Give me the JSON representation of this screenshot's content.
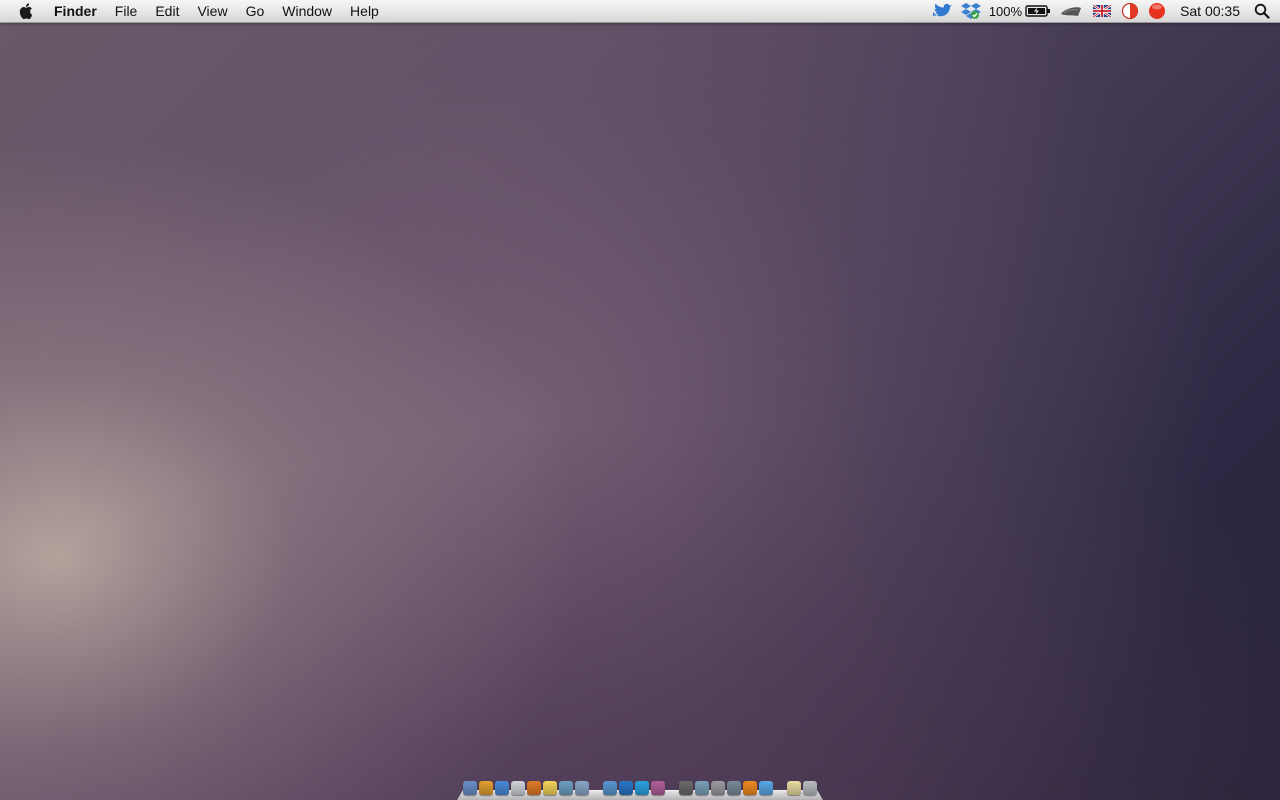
{
  "menubar": {
    "app_name": "Finder",
    "menus": [
      "File",
      "Edit",
      "View",
      "Go",
      "Window",
      "Help"
    ],
    "battery": "100%",
    "clock": "Sat 00:35"
  },
  "status_icons": [
    "twitter-icon",
    "dropbox-icon",
    "battery-icon",
    "wifi-icon",
    "input-flag-uk-icon",
    "display-toggle-icon",
    "record-dot-icon",
    "spotlight-icon"
  ],
  "dock": {
    "apps": [
      {
        "name": "finder-icon",
        "color": "#6a8fc8"
      },
      {
        "name": "chrome-icon",
        "color": "#e0a030"
      },
      {
        "name": "safari-icon",
        "color": "#4a8ad8"
      },
      {
        "name": "preview-icon",
        "color": "#cfd4da"
      },
      {
        "name": "tasks-icon",
        "color": "#e07a28"
      },
      {
        "name": "notes-icon",
        "color": "#f2d35a"
      },
      {
        "name": "photos-icon",
        "color": "#6fa0c0"
      },
      {
        "name": "app-store-icon",
        "color": "#8aa6c8"
      },
      {
        "name": "mail-icon",
        "color": "#5a98d0"
      },
      {
        "name": "twitter-app-icon",
        "color": "#2a75c8"
      },
      {
        "name": "skype-icon",
        "color": "#2aa2e0"
      },
      {
        "name": "itunes-icon",
        "color": "#b0609a"
      },
      {
        "name": "cloud-icon",
        "color": "#6a6a6a"
      },
      {
        "name": "media-icon",
        "color": "#7aa0b8"
      },
      {
        "name": "system-preferences-icon",
        "color": "#9a9aa0"
      },
      {
        "name": "network-icon",
        "color": "#7a8a9a"
      },
      {
        "name": "vlc-icon",
        "color": "#f08a20"
      },
      {
        "name": "globe-icon",
        "color": "#5aa8e8"
      },
      {
        "name": "documents-stack-icon",
        "color": "#e8dca0"
      },
      {
        "name": "trash-icon",
        "color": "#b8bcc0"
      }
    ]
  }
}
